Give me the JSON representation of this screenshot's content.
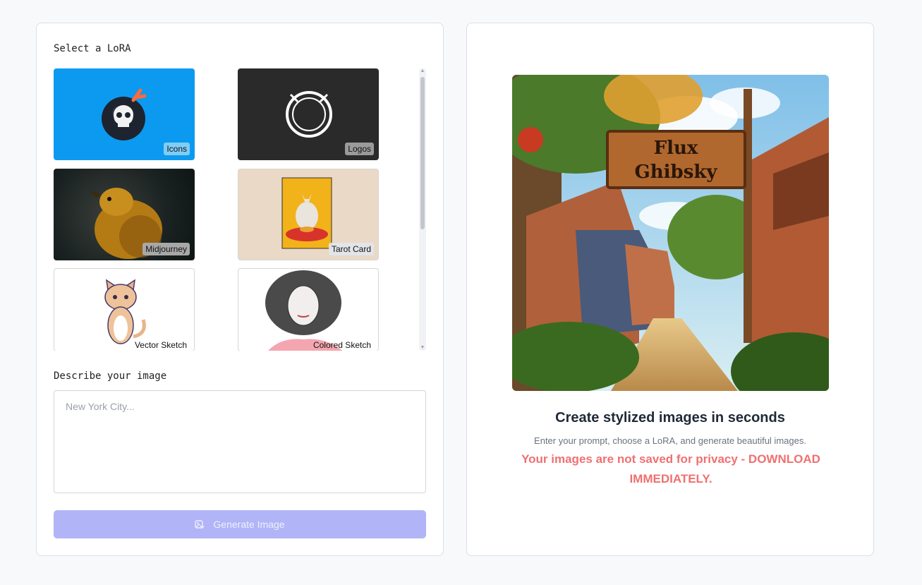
{
  "left": {
    "select_label": "Select a LoRA",
    "loras": [
      {
        "label": "Icons"
      },
      {
        "label": "Logos"
      },
      {
        "label": "Midjourney"
      },
      {
        "label": "Tarot Card"
      },
      {
        "label": "Vector Sketch"
      },
      {
        "label": "Colored Sketch"
      }
    ],
    "describe_label": "Describe your image",
    "prompt_placeholder": "New York City...",
    "generate_label": "Generate Image"
  },
  "right": {
    "hero_sign_line1": "Flux",
    "hero_sign_line2": "Ghibsky",
    "headline": "Create stylized images in seconds",
    "subtext": "Enter your prompt, choose a LoRA, and generate beautiful images.",
    "warning": "Your images are not saved for privacy - DOWNLOAD IMMEDIATELY."
  },
  "colors": {
    "accent_button": "#b1b4f6",
    "warning": "#f07070",
    "icons_card": "#0b9af0"
  },
  "icons": {
    "generate": "image-plus-icon"
  }
}
